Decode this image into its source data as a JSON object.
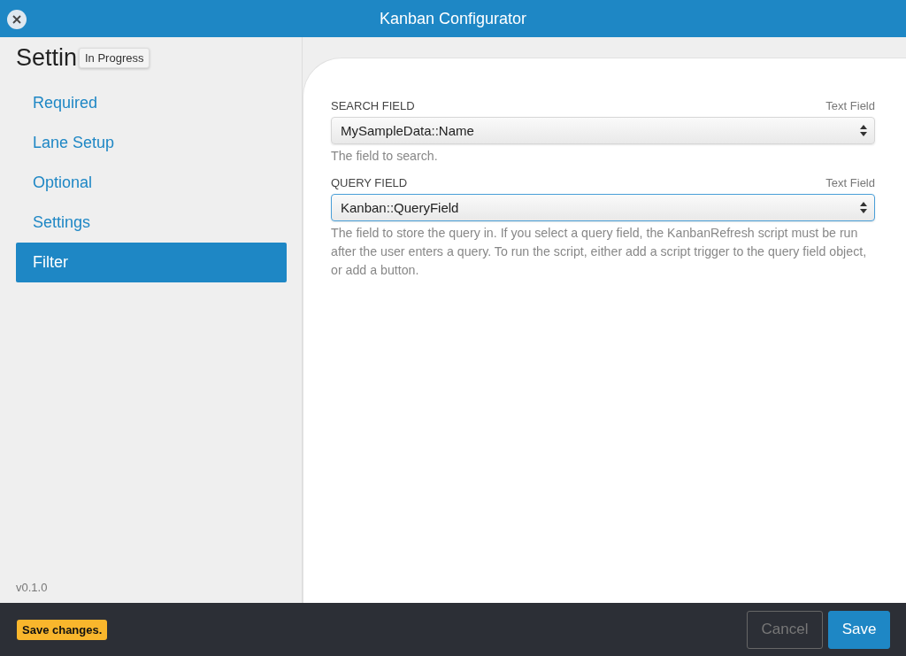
{
  "window": {
    "title": "Kanban Configurator"
  },
  "sidebar": {
    "heading": "Settin",
    "tooltip": "In Progress",
    "items": [
      {
        "label": "Required",
        "selected": false
      },
      {
        "label": "Lane Setup",
        "selected": false
      },
      {
        "label": "Optional",
        "selected": false
      },
      {
        "label": "Settings",
        "selected": false
      },
      {
        "label": "Filter",
        "selected": true
      }
    ],
    "version": "v0.1.0"
  },
  "fields": [
    {
      "label": "SEARCH FIELD",
      "type": "Text Field",
      "value": "MySampleData::Name",
      "focused": false,
      "help": "The field to search."
    },
    {
      "label": "QUERY FIELD",
      "type": "Text Field",
      "value": "Kanban::QueryField",
      "focused": true,
      "help": "The field to store the query in. If you select a query field, the KanbanRefresh script must be run after the user enters a query. To run the script, either add a script trigger to the query field object, or add a button."
    }
  ],
  "footer": {
    "status": "Save changes.",
    "buttons": [
      {
        "label": "Cancel",
        "kind": "secondary",
        "disabled": true
      },
      {
        "label": "Save",
        "kind": "primary",
        "disabled": false
      }
    ]
  }
}
